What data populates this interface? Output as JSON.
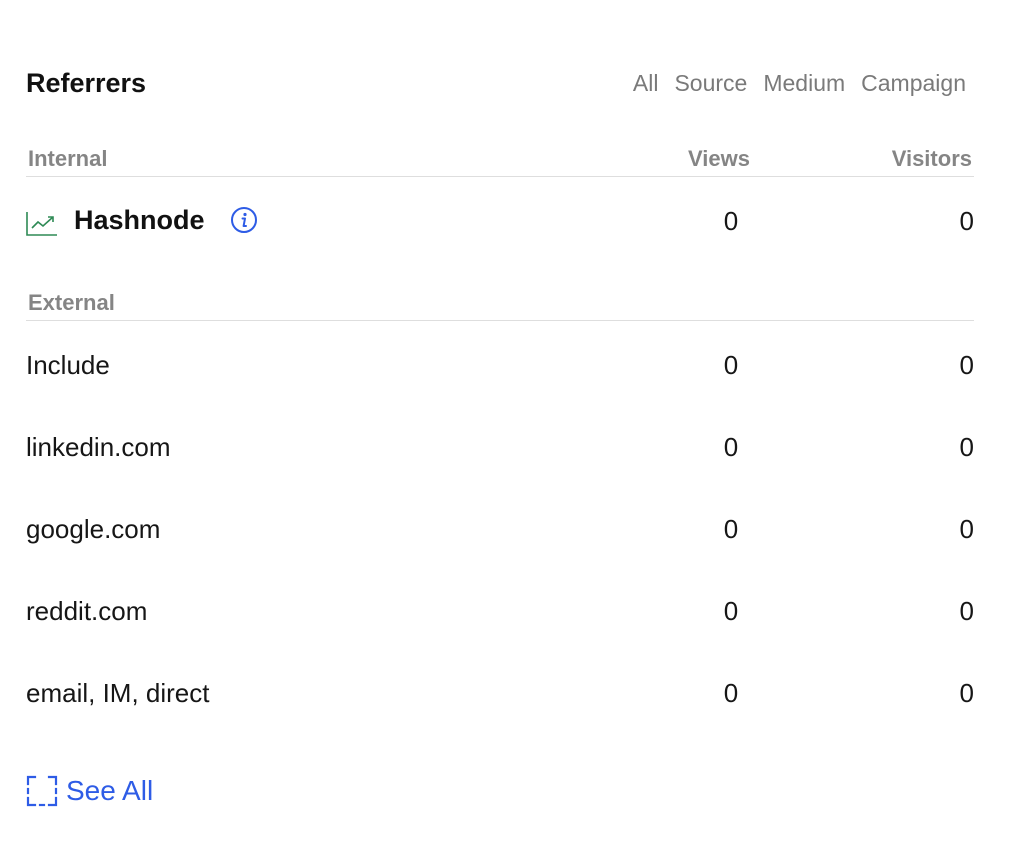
{
  "title": "Referrers",
  "filters": [
    "All",
    "Source",
    "Medium",
    "Campaign"
  ],
  "columns": {
    "views": "Views",
    "visitors": "Visitors"
  },
  "internal": {
    "header": "Internal",
    "row": {
      "label": "Hashnode",
      "views": "0",
      "visitors": "0",
      "icon": "trend-chart-icon",
      "info_icon": "info-icon"
    }
  },
  "external": {
    "header": "External",
    "rows": [
      {
        "label": "Include",
        "views": "0",
        "visitors": "0"
      },
      {
        "label": "linkedin.com",
        "views": "0",
        "visitors": "0"
      },
      {
        "label": "google.com",
        "views": "0",
        "visitors": "0"
      },
      {
        "label": "reddit.com",
        "views": "0",
        "visitors": "0"
      },
      {
        "label": "email, IM, direct",
        "views": "0",
        "visitors": "0"
      }
    ]
  },
  "see_all": {
    "label": "See All",
    "icon": "expand-icon"
  },
  "colors": {
    "accent": "#2e5ce6",
    "trend": "#2e8a55",
    "muted": "#858585",
    "divider": "#dedede"
  }
}
